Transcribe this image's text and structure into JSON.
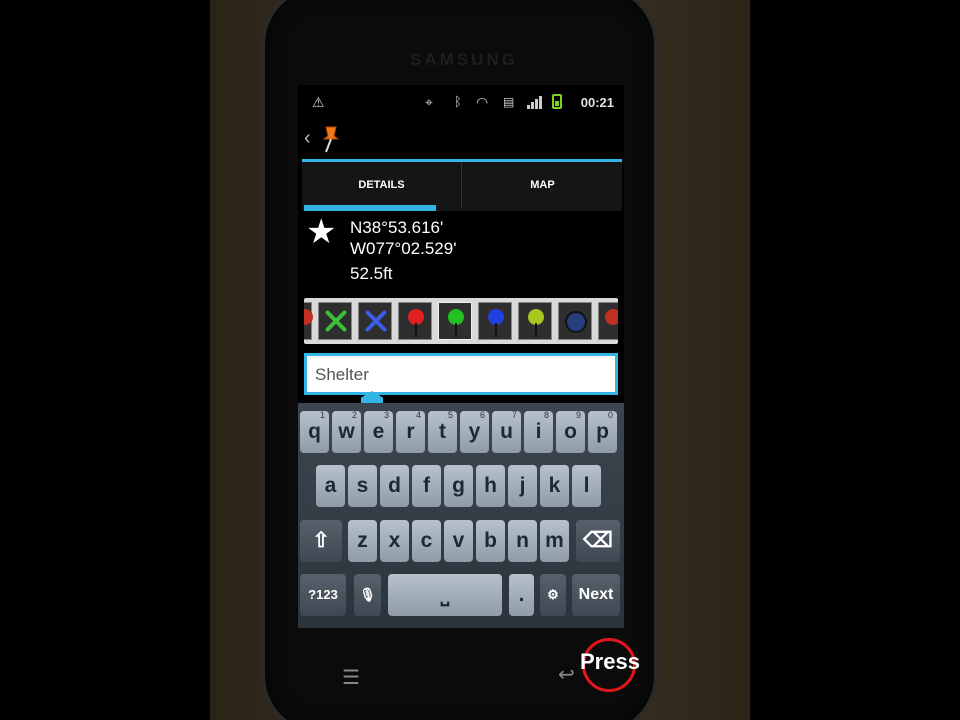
{
  "device": {
    "brand": "SAMSUNG"
  },
  "status_bar": {
    "time": "00:21",
    "icons": [
      "warning-icon",
      "gps-icon",
      "bluetooth-icon",
      "wifi-icon",
      "sd-card-icon",
      "signal-icon",
      "battery-icon"
    ]
  },
  "action_bar": {
    "back_icon": "chevron-left-icon",
    "app_icon": "pushpin-icon"
  },
  "tabs": [
    {
      "label": "DETAILS",
      "selected": true
    },
    {
      "label": "MAP",
      "selected": false
    }
  ],
  "waypoint": {
    "latitude": "N38°53.616'",
    "longitude": "W077°02.529'",
    "elevation": "52.5ft"
  },
  "symbols": [
    {
      "name": "x-green",
      "color": "#3ac13a"
    },
    {
      "name": "x-blue",
      "color": "#3b5de7"
    },
    {
      "name": "pin-red",
      "color": "#e02020"
    },
    {
      "name": "pin-green",
      "color": "#22c022"
    },
    {
      "name": "pin-blue",
      "color": "#2040e0"
    },
    {
      "name": "pin-yellow-green",
      "color": "#a8c81e"
    },
    {
      "name": "dot-navy",
      "color": "#243f7a"
    }
  ],
  "name_field": {
    "value": "Shelter"
  },
  "keyboard": {
    "row1": [
      {
        "k": "q",
        "h": "1"
      },
      {
        "k": "w",
        "h": "2"
      },
      {
        "k": "e",
        "h": "3"
      },
      {
        "k": "r",
        "h": "4"
      },
      {
        "k": "t",
        "h": "5"
      },
      {
        "k": "y",
        "h": "6"
      },
      {
        "k": "u",
        "h": "7"
      },
      {
        "k": "i",
        "h": "8"
      },
      {
        "k": "o",
        "h": "9"
      },
      {
        "k": "p",
        "h": "0"
      }
    ],
    "row2": [
      "a",
      "s",
      "d",
      "f",
      "g",
      "h",
      "j",
      "k",
      "l"
    ],
    "row3": [
      "z",
      "x",
      "c",
      "v",
      "b",
      "n",
      "m"
    ],
    "shift": "⇧",
    "backspace": "⌫",
    "numbers": "?123",
    "mic": "🎙",
    "space": "⎵",
    "period": ".",
    "settings": "⚙",
    "next": "Next"
  },
  "overlay": {
    "press_label": "Press"
  }
}
